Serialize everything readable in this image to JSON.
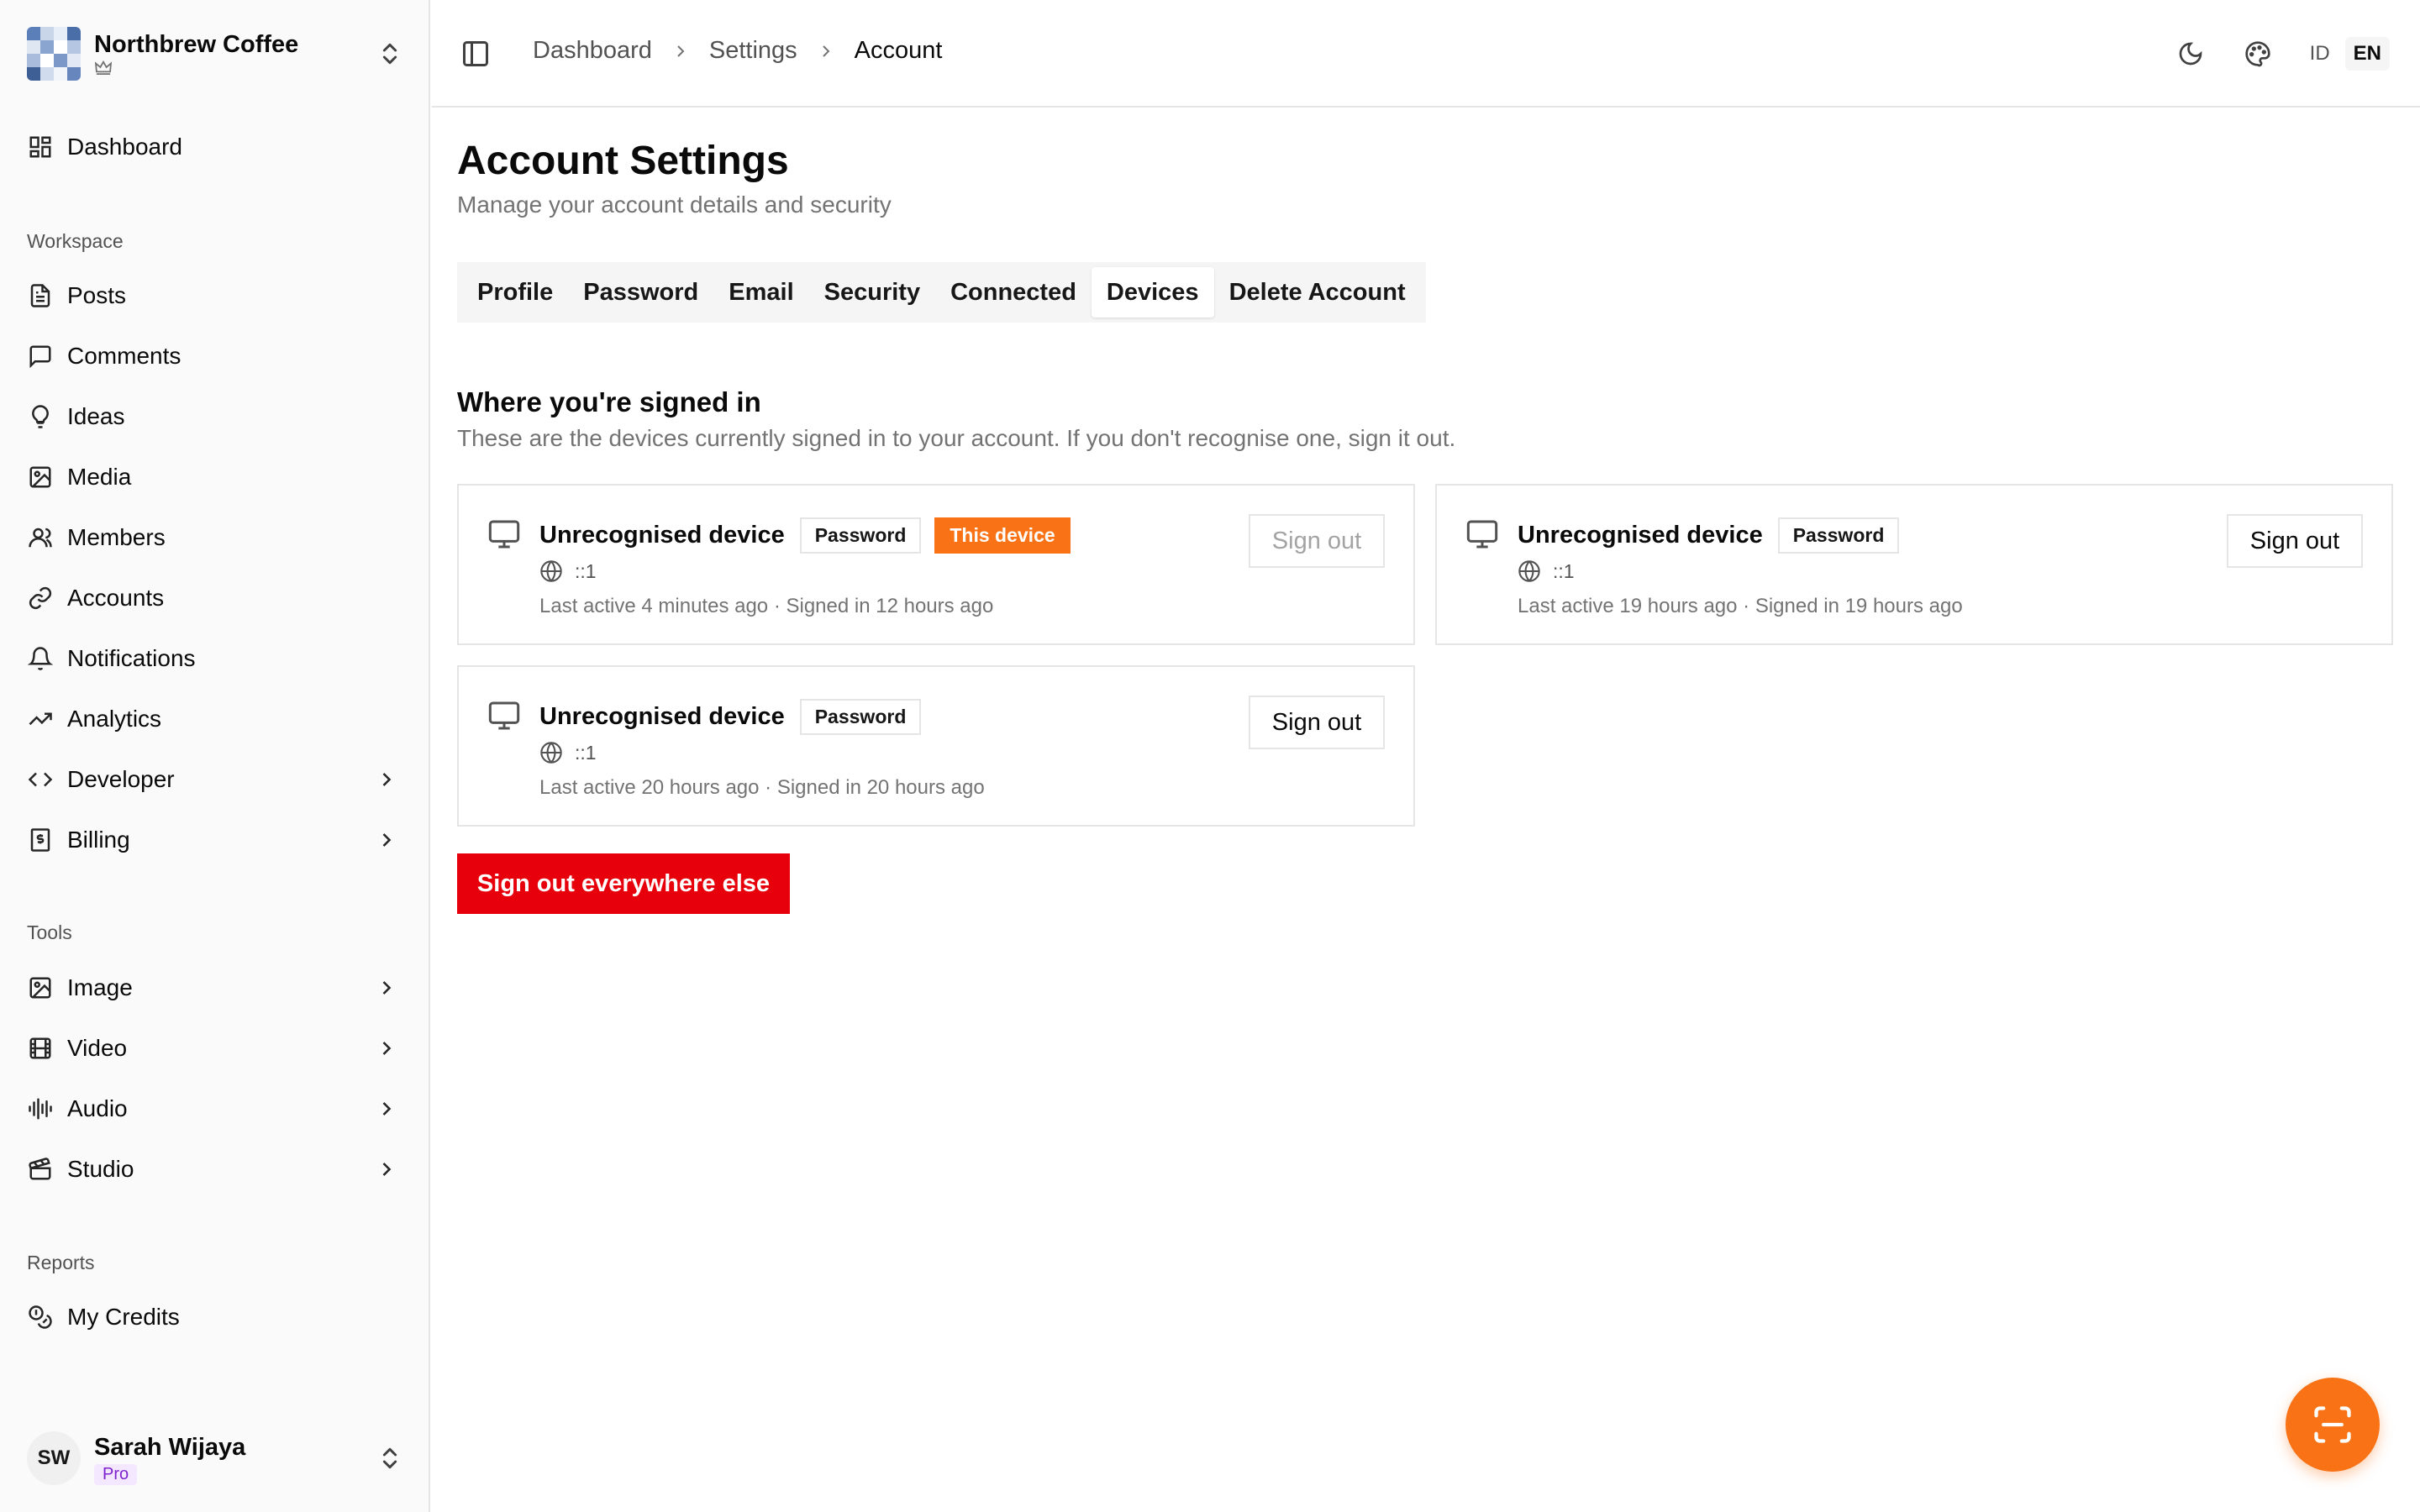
{
  "org": {
    "name": "Northbrew Coffee",
    "plan_icon": "crown-icon"
  },
  "sidebar": {
    "top": [
      {
        "label": "Dashboard",
        "icon": "dashboard-icon"
      }
    ],
    "workspace_label": "Workspace",
    "workspace": [
      {
        "label": "Posts",
        "icon": "file-text-icon"
      },
      {
        "label": "Comments",
        "icon": "message-square-icon"
      },
      {
        "label": "Ideas",
        "icon": "lightbulb-icon"
      },
      {
        "label": "Media",
        "icon": "image-icon"
      },
      {
        "label": "Members",
        "icon": "users-icon"
      },
      {
        "label": "Accounts",
        "icon": "link-icon"
      },
      {
        "label": "Notifications",
        "icon": "bell-icon"
      },
      {
        "label": "Analytics",
        "icon": "trending-up-icon"
      },
      {
        "label": "Developer",
        "icon": "code-icon"
      },
      {
        "label": "Billing",
        "icon": "receipt-icon"
      }
    ],
    "tools_label": "Tools",
    "tools": [
      {
        "label": "Image",
        "icon": "image-icon"
      },
      {
        "label": "Video",
        "icon": "film-icon"
      },
      {
        "label": "Audio",
        "icon": "audio-lines-icon"
      },
      {
        "label": "Studio",
        "icon": "clapperboard-icon"
      }
    ],
    "reports_label": "Reports",
    "reports": [
      {
        "label": "My Credits",
        "icon": "coins-icon"
      }
    ]
  },
  "user": {
    "initials": "SW",
    "name": "Sarah Wijaya",
    "badge": "Pro"
  },
  "breadcrumb": [
    "Dashboard",
    "Settings",
    "Account"
  ],
  "header": {
    "lang_id": "ID",
    "lang_en": "EN",
    "active_lang": "EN"
  },
  "page": {
    "title": "Account Settings",
    "subtitle": "Manage your account details and security"
  },
  "tabs": [
    "Profile",
    "Password",
    "Email",
    "Security",
    "Connected",
    "Devices",
    "Delete Account"
  ],
  "active_tab": "Devices",
  "devices_section": {
    "title": "Where you're signed in",
    "description": "These are the devices currently signed in to your account. If you don't recognise one, sign it out."
  },
  "devices": [
    {
      "name": "Unrecognised device",
      "method": "Password",
      "current_label": "This device",
      "ip": "::1",
      "meta": "Last active 4 minutes ago · Signed in 12 hours ago",
      "action": "Sign out"
    },
    {
      "name": "Unrecognised device",
      "method": "Password",
      "ip": "::1",
      "meta": "Last active 19 hours ago · Signed in 19 hours ago",
      "action": "Sign out"
    },
    {
      "name": "Unrecognised device",
      "method": "Password",
      "ip": "::1",
      "meta": "Last active 20 hours ago · Signed in 20 hours ago",
      "action": "Sign out"
    }
  ],
  "sign_out_all": "Sign out everywhere else",
  "colors": {
    "accent": "#f97316",
    "danger": "#e7000b",
    "pro_badge": "#7e22ce"
  },
  "fab_icon": "scan-icon"
}
